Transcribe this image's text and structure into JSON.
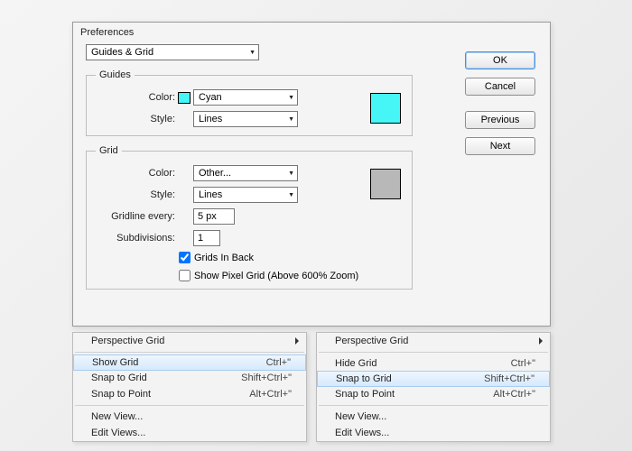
{
  "window": {
    "title": "Preferences"
  },
  "category": {
    "value": "Guides & Grid"
  },
  "guides": {
    "legend": "Guides",
    "colorLabel": "Color:",
    "colorValue": "Cyan",
    "colorHex": "#46f6f6",
    "styleLabel": "Style:",
    "styleValue": "Lines"
  },
  "grid": {
    "legend": "Grid",
    "colorLabel": "Color:",
    "colorValue": "Other...",
    "colorHex": "#b8b8b8",
    "styleLabel": "Style:",
    "styleValue": "Lines",
    "everyLabel": "Gridline every:",
    "everyValue": "5 px",
    "subdivLabel": "Subdivisions:",
    "subdivValue": "1",
    "gridsInBackLabel": "Grids In Back",
    "gridsInBackChecked": true,
    "pixelGridLabel": "Show Pixel Grid (Above 600% Zoom)",
    "pixelGridChecked": false
  },
  "buttons": {
    "ok": "OK",
    "cancel": "Cancel",
    "previous": "Previous",
    "next": "Next"
  },
  "menuLeft": {
    "perspective": "Perspective Grid",
    "showGrid": "Show Grid",
    "showGridShortcut": "Ctrl+\"",
    "snapGrid": "Snap to Grid",
    "snapGridShortcut": "Shift+Ctrl+\"",
    "snapPoint": "Snap to Point",
    "snapPointShortcut": "Alt+Ctrl+\"",
    "newView": "New View...",
    "editViews": "Edit Views..."
  },
  "menuRight": {
    "perspective": "Perspective Grid",
    "hideGrid": "Hide Grid",
    "hideGridShortcut": "Ctrl+\"",
    "snapGrid": "Snap to Grid",
    "snapGridShortcut": "Shift+Ctrl+\"",
    "snapPoint": "Snap to Point",
    "snapPointShortcut": "Alt+Ctrl+\"",
    "newView": "New View...",
    "editViews": "Edit Views..."
  }
}
